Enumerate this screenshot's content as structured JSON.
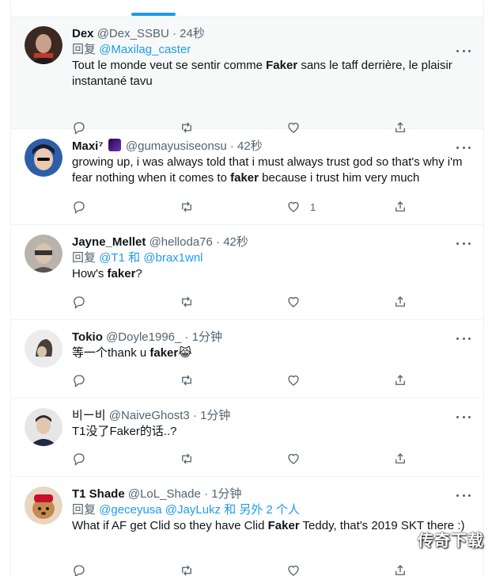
{
  "tweets": [
    {
      "name": "Dex",
      "handle": "@Dex_SSBU",
      "dot": "·",
      "time": "24秒",
      "reply_prefix": "回复",
      "reply_mentions": "@Maxilag_caster",
      "text_pre": "Tout le monde veut se sentir comme ",
      "text_bold": "Faker",
      "text_post": " sans le taff derrière, le plaisir instantané tavu",
      "likes": ""
    },
    {
      "name": "Maxi⁷",
      "handle": "@gumayusiseonsu",
      "dot": "·",
      "time": "42秒",
      "text_pre": "growing up, i was always told that i must always trust god so that's why i'm fear nothing when it comes to ",
      "text_bold": "faker",
      "text_post": " because i trust him very much",
      "likes": "1"
    },
    {
      "name": "Jayne_Mellet",
      "handle": "@helloda76",
      "dot": "·",
      "time": "42秒",
      "reply_prefix": "回复",
      "reply_mentions": "@T1 和 @brax1wnl",
      "text_pre": "How's ",
      "text_bold": "faker",
      "text_post": "?",
      "likes": ""
    },
    {
      "name": "Tokio",
      "handle": "@Doyle1996_",
      "dot": "·",
      "time": "1分钟",
      "text_pre": "等一个thank u ",
      "text_bold": "faker",
      "text_post": " 😹",
      "likes": ""
    },
    {
      "name": "비ー비",
      "handle": "@NaiveGhost3",
      "dot": "·",
      "time": "1分钟",
      "text_pre": "T1没了Faker的话..?",
      "text_bold": "",
      "text_post": "",
      "likes": ""
    },
    {
      "name": "T1 Shade",
      "handle": "@LoL_Shade",
      "dot": "·",
      "time": "1分钟",
      "reply_prefix": "回复",
      "reply_mentions": "@geceyusa @JayLukz 和 另外 2 个人",
      "text_pre": "What if AF get Clid so they have Clid ",
      "text_bold": "Faker",
      "text_post": " Teddy, that's 2019 SKT there :)",
      "likes": ""
    }
  ],
  "watermark": "传奇下载",
  "icons": {
    "reply": "reply-icon",
    "retweet": "retweet-icon",
    "like": "heart-icon",
    "share": "share-icon",
    "more": "more-icon"
  },
  "colors": {
    "accent": "#1d9bf0",
    "secondary_text": "#536471",
    "highlight_bg": "#f7f9f9"
  }
}
